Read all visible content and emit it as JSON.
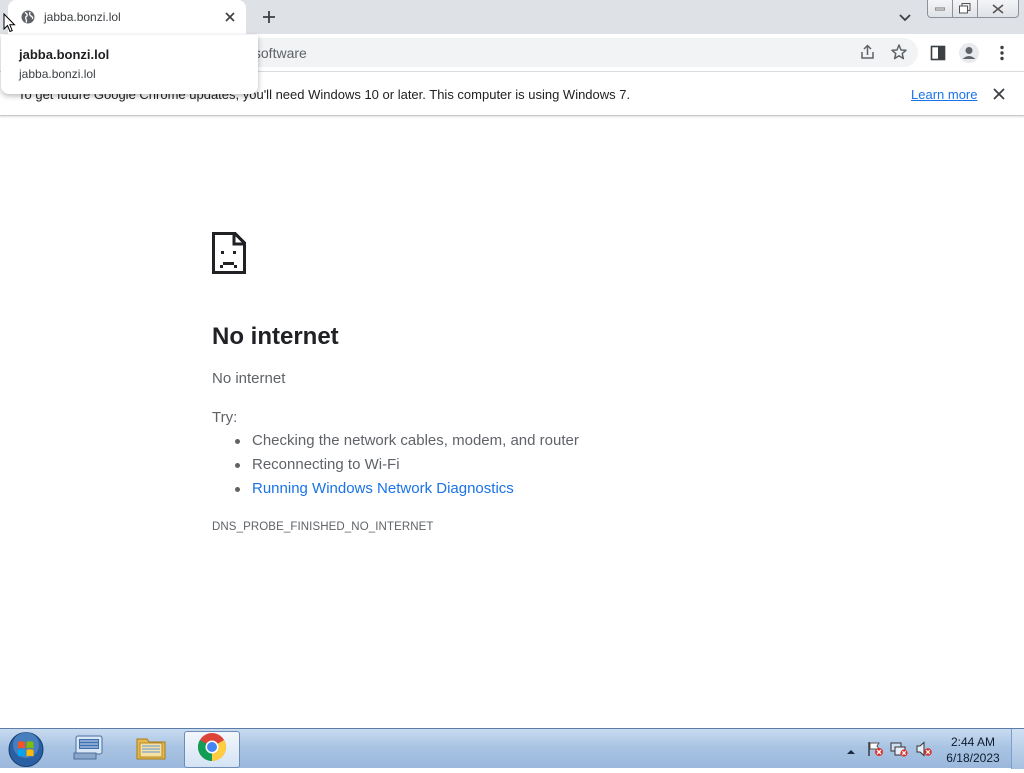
{
  "tab": {
    "title": "jabba.bonzi.lol"
  },
  "hovercard": {
    "title": "jabba.bonzi.lol",
    "domain": "jabba.bonzi.lol"
  },
  "omnibox": {
    "url_visible": "/software"
  },
  "infobar": {
    "message": "To get future Google Chrome updates, you'll need Windows 10 or later. This computer is using Windows 7.",
    "learn_more": "Learn more"
  },
  "error_page": {
    "heading": "No internet",
    "subheading": "No internet",
    "try_label": "Try:",
    "suggestions": [
      "Checking the network cables, modem, and router",
      "Reconnecting to Wi-Fi",
      "Running Windows Network Diagnostics"
    ],
    "error_code": "DNS_PROBE_FINISHED_NO_INTERNET"
  },
  "taskbar": {
    "clock_time": "2:44 AM",
    "clock_date": "6/18/2023"
  },
  "colors": {
    "link": "#1a73e8",
    "tabstrip": "#dee1e6",
    "text": "#202124",
    "secondary_text": "#5f6368"
  }
}
